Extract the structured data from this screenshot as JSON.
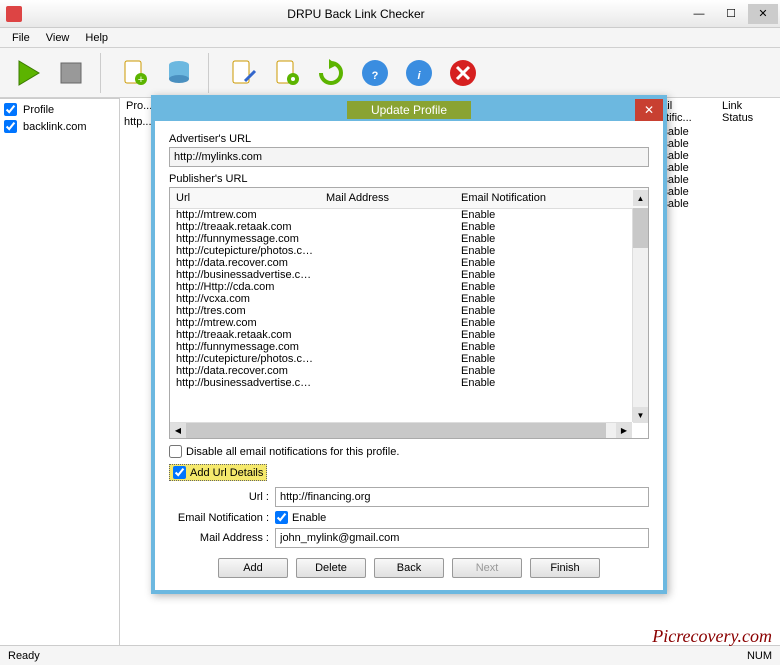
{
  "window": {
    "title": "DRPU Back Link Checker",
    "menus": [
      "File",
      "View",
      "Help"
    ]
  },
  "statusbar": {
    "left": "Ready",
    "right": "NUM"
  },
  "watermark": "Picrecovery.com",
  "left_pane": {
    "header": "Profile",
    "items": [
      "backlink.com"
    ]
  },
  "bg_grid": {
    "col_profile": "Pro...",
    "row_profile": "http...",
    "right_headers": [
      "mail Notific...",
      "Link Status"
    ],
    "disable_text": "Disable",
    "disable_count": 7
  },
  "dialog": {
    "title": "Update Profile",
    "advertiser_label": "Advertiser's URL",
    "advertiser_value": "http://mylinks.com",
    "publisher_label": "Publisher's URL",
    "pub_headers": {
      "url": "Url",
      "mail": "Mail Address",
      "email_notif": "Email Notification"
    },
    "pub_rows": [
      {
        "url": "http://mtrew.com",
        "en": "Enable"
      },
      {
        "url": "http://treaak.retaak.com",
        "en": "Enable"
      },
      {
        "url": "http://funnymessage.com",
        "en": "Enable"
      },
      {
        "url": "http://cutepicture/photos.com",
        "en": "Enable"
      },
      {
        "url": "http://data.recover.com",
        "en": "Enable"
      },
      {
        "url": "http://businessadvertise.com",
        "en": "Enable"
      },
      {
        "url": "http://Http://cda.com",
        "en": "Enable"
      },
      {
        "url": "http://vcxa.com",
        "en": "Enable"
      },
      {
        "url": "http://tres.com",
        "en": "Enable"
      },
      {
        "url": "http://mtrew.com",
        "en": "Enable"
      },
      {
        "url": "http://treaak.retaak.com",
        "en": "Enable"
      },
      {
        "url": "http://funnymessage.com",
        "en": "Enable"
      },
      {
        "url": "http://cutepicture/photos.com",
        "en": "Enable"
      },
      {
        "url": "http://data.recover.com",
        "en": "Enable"
      },
      {
        "url": "http://businessadvertise.com",
        "en": "Enable"
      }
    ],
    "disable_all_label": "Disable all email notifications for this profile.",
    "add_details_label": "Add Url Details",
    "form": {
      "url_label": "Url :",
      "url_value": "http://financing.org",
      "email_notif_label": "Email Notification :",
      "enable_label": "Enable",
      "mail_label": "Mail Address :",
      "mail_value": "john_mylink@gmail.com"
    },
    "buttons": {
      "add": "Add",
      "delete": "Delete",
      "back": "Back",
      "next": "Next",
      "finish": "Finish"
    }
  }
}
